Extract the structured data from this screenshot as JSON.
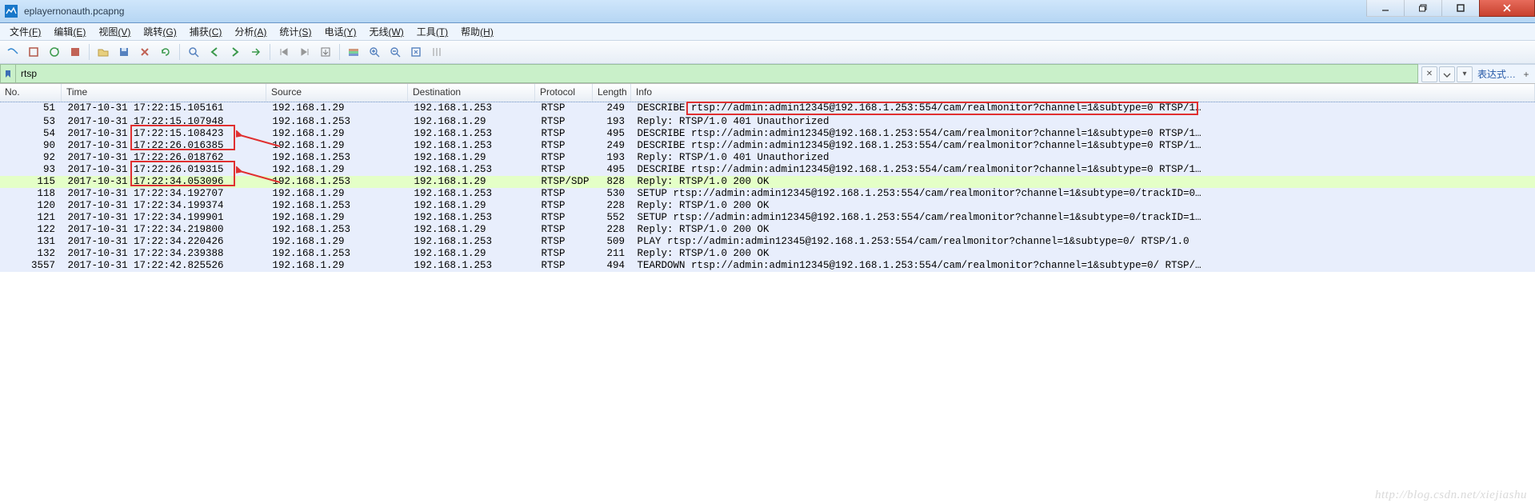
{
  "window": {
    "title": "eplayernonauth.pcapng"
  },
  "menu": [
    {
      "label": "文件",
      "accel": "(F)"
    },
    {
      "label": "编辑",
      "accel": "(E)"
    },
    {
      "label": "视图",
      "accel": "(V)"
    },
    {
      "label": "跳转",
      "accel": "(G)"
    },
    {
      "label": "捕获",
      "accel": "(C)"
    },
    {
      "label": "分析",
      "accel": "(A)"
    },
    {
      "label": "统计",
      "accel": "(S)"
    },
    {
      "label": "电话",
      "accel": "(Y)"
    },
    {
      "label": "无线",
      "accel": "(W)"
    },
    {
      "label": "工具",
      "accel": "(T)"
    },
    {
      "label": "帮助",
      "accel": "(H)"
    }
  ],
  "filter": {
    "value": "rtsp",
    "expr_label": "表达式…"
  },
  "columns": {
    "no": "No.",
    "time": "Time",
    "src": "Source",
    "dst": "Destination",
    "prot": "Protocol",
    "len": "Length",
    "info": "Info"
  },
  "colors": {
    "row_selected": "#d7e5fa",
    "row_http": "#e4ffc7",
    "row_plain": "#e8eefc",
    "annot_red": "#e03030"
  },
  "packets": [
    {
      "no": 51,
      "time": "2017-10-31 17:22:15.105161",
      "src": "192.168.1.29",
      "dst": "192.168.1.253",
      "prot": "RTSP",
      "len": 249,
      "info": "DESCRIBE rtsp://admin:admin12345@192.168.1.253:554/cam/realmonitor?channel=1&subtype=0 RTSP/1…",
      "sel": true
    },
    {
      "no": 53,
      "time": "2017-10-31 17:22:15.107948",
      "src": "192.168.1.253",
      "dst": "192.168.1.29",
      "prot": "RTSP",
      "len": 193,
      "info": "Reply: RTSP/1.0 401 Unauthorized"
    },
    {
      "no": 54,
      "time": "2017-10-31 17:22:15.108423",
      "src": "192.168.1.29",
      "dst": "192.168.1.253",
      "prot": "RTSP",
      "len": 495,
      "info": "DESCRIBE rtsp://admin:admin12345@192.168.1.253:554/cam/realmonitor?channel=1&subtype=0 RTSP/1…"
    },
    {
      "no": 90,
      "time": "2017-10-31 17:22:26.016385",
      "src": "192.168.1.29",
      "dst": "192.168.1.253",
      "prot": "RTSP",
      "len": 249,
      "info": "DESCRIBE rtsp://admin:admin12345@192.168.1.253:554/cam/realmonitor?channel=1&subtype=0 RTSP/1…"
    },
    {
      "no": 92,
      "time": "2017-10-31 17:22:26.018762",
      "src": "192.168.1.253",
      "dst": "192.168.1.29",
      "prot": "RTSP",
      "len": 193,
      "info": "Reply: RTSP/1.0 401 Unauthorized"
    },
    {
      "no": 93,
      "time": "2017-10-31 17:22:26.019315",
      "src": "192.168.1.29",
      "dst": "192.168.1.253",
      "prot": "RTSP",
      "len": 495,
      "info": "DESCRIBE rtsp://admin:admin12345@192.168.1.253:554/cam/realmonitor?channel=1&subtype=0 RTSP/1…"
    },
    {
      "no": 115,
      "time": "2017-10-31 17:22:34.053096",
      "src": "192.168.1.253",
      "dst": "192.168.1.29",
      "prot": "RTSP/SDP",
      "len": 828,
      "info": "Reply: RTSP/1.0 200 OK"
    },
    {
      "no": 118,
      "time": "2017-10-31 17:22:34.192707",
      "src": "192.168.1.29",
      "dst": "192.168.1.253",
      "prot": "RTSP",
      "len": 530,
      "info": "SETUP rtsp://admin:admin12345@192.168.1.253:554/cam/realmonitor?channel=1&subtype=0/trackID=0…"
    },
    {
      "no": 120,
      "time": "2017-10-31 17:22:34.199374",
      "src": "192.168.1.253",
      "dst": "192.168.1.29",
      "prot": "RTSP",
      "len": 228,
      "info": "Reply: RTSP/1.0 200 OK"
    },
    {
      "no": 121,
      "time": "2017-10-31 17:22:34.199901",
      "src": "192.168.1.29",
      "dst": "192.168.1.253",
      "prot": "RTSP",
      "len": 552,
      "info": "SETUP rtsp://admin:admin12345@192.168.1.253:554/cam/realmonitor?channel=1&subtype=0/trackID=1…"
    },
    {
      "no": 122,
      "time": "2017-10-31 17:22:34.219800",
      "src": "192.168.1.253",
      "dst": "192.168.1.29",
      "prot": "RTSP",
      "len": 228,
      "info": "Reply: RTSP/1.0 200 OK"
    },
    {
      "no": 131,
      "time": "2017-10-31 17:22:34.220426",
      "src": "192.168.1.29",
      "dst": "192.168.1.253",
      "prot": "RTSP",
      "len": 509,
      "info": "PLAY rtsp://admin:admin12345@192.168.1.253:554/cam/realmonitor?channel=1&subtype=0/ RTSP/1.0"
    },
    {
      "no": 132,
      "time": "2017-10-31 17:22:34.239388",
      "src": "192.168.1.253",
      "dst": "192.168.1.29",
      "prot": "RTSP",
      "len": 211,
      "info": "Reply: RTSP/1.0 200 OK"
    },
    {
      "no": 3557,
      "time": "2017-10-31 17:22:42.825526",
      "src": "192.168.1.29",
      "dst": "192.168.1.253",
      "prot": "RTSP",
      "len": 494,
      "info": "TEARDOWN rtsp://admin:admin12345@192.168.1.253:554/cam/realmonitor?channel=1&subtype=0/ RTSP/…"
    }
  ],
  "watermark": "http://blog.csdn.net/xiejiashu"
}
